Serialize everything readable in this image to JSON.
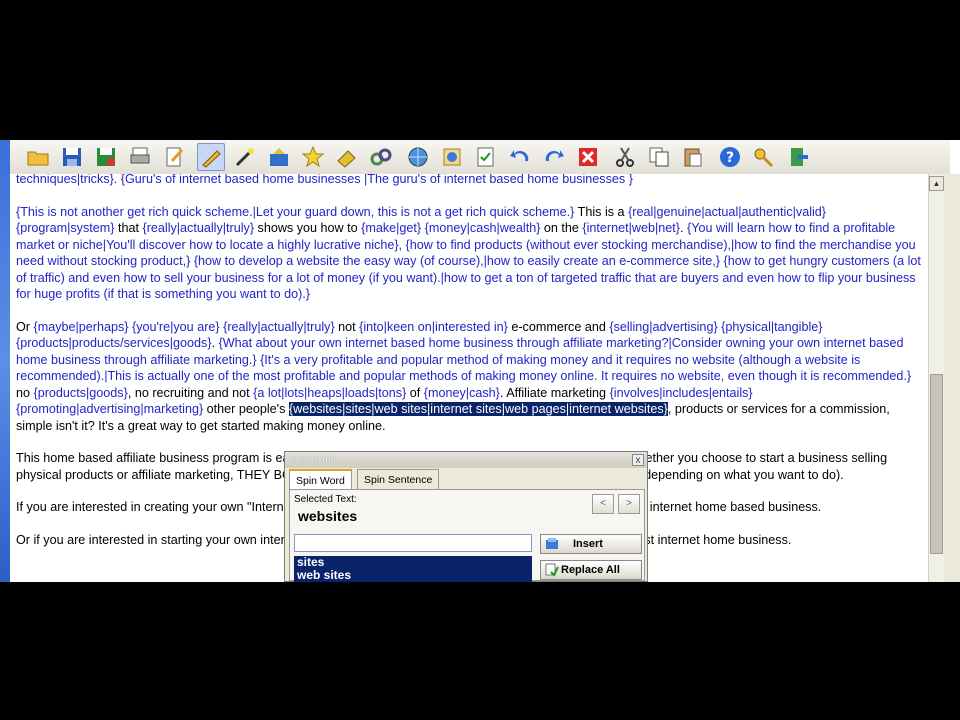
{
  "colors": {
    "spin": "#2323c8",
    "selection": "#0a246a",
    "toolbar": "#ece9d8"
  },
  "toolbar": {
    "icons": [
      "open-folder-icon",
      "save-icon",
      "save-as-icon",
      "print-icon",
      "edit-document-icon",
      "pencil-icon",
      "wand-icon",
      "magic-chest-icon",
      "star-icon",
      "eraser-icon",
      "link-icon",
      "globe-icon",
      "spell-check-icon",
      "checklist-icon",
      "undo-icon",
      "redo-icon",
      "delete-icon",
      "cut-icon",
      "copy-icon",
      "paste-icon",
      "help-icon",
      "key-icon",
      "exit-icon"
    ]
  },
  "document": {
    "line0": [
      {
        "t": "techniques|tricks}. {Guru's of internet based home businesses |The guru's of internet based home businesses }",
        "s": true
      }
    ],
    "para1": [
      {
        "t": "{This is not another get rich quick scheme.|Let your guard down, this is not a get rich quick scheme.}",
        "s": true
      },
      {
        "t": " This is a ",
        "s": false
      },
      {
        "t": "{real|genuine|actual|authentic|valid}",
        "s": true
      },
      {
        "t": " ",
        "s": false
      },
      {
        "t": "{program|system}",
        "s": true
      },
      {
        "t": " that ",
        "s": false
      },
      {
        "t": "{really|actually|truly}",
        "s": true
      },
      {
        "t": " shows you how to ",
        "s": false
      },
      {
        "t": "{make|get}",
        "s": true
      },
      {
        "t": " ",
        "s": false
      },
      {
        "t": "{money|cash|wealth}",
        "s": true
      },
      {
        "t": " on the ",
        "s": false
      },
      {
        "t": "{internet|web|net}",
        "s": true
      },
      {
        "t": ". ",
        "s": false
      },
      {
        "t": "{You will learn how to find a profitable market or niche|You'll discover how to locate a highly lucrative niche}, {how to find products (without ever stocking merchandise),|how to find the merchandise you need without stocking product,} {how to develop a website the easy way (of course),|how to easily create an e-commerce site,} {how to get hungry customers (a lot of traffic) and even how to sell your business for a lot of money (if you want).|how to get a ton of targeted traffic that are buyers and even how to flip your business for huge profits (if that is something you want to do).}",
        "s": true
      }
    ],
    "para2": [
      {
        "t": "Or ",
        "s": false
      },
      {
        "t": "{maybe|perhaps}",
        "s": true
      },
      {
        "t": " ",
        "s": false
      },
      {
        "t": "{you're|you are}",
        "s": true
      },
      {
        "t": " ",
        "s": false
      },
      {
        "t": "{really|actually|truly}",
        "s": true
      },
      {
        "t": " not ",
        "s": false
      },
      {
        "t": "{into|keen on|interested in}",
        "s": true
      },
      {
        "t": " e-commerce and ",
        "s": false
      },
      {
        "t": "{selling|advertising}",
        "s": true
      },
      {
        "t": " ",
        "s": false
      },
      {
        "t": "{physical|tangible}",
        "s": true
      },
      {
        "t": " ",
        "s": false
      },
      {
        "t": "{products|products/services|goods}",
        "s": true
      },
      {
        "t": ". ",
        "s": false
      },
      {
        "t": "{What about your own internet based home business through affiliate marketing?|Consider owning your own internet based home business through affiliate marketing.} {It's a very profitable and popular method of making money and it requires no website (although a website is recommended).|This is actually one of the most profitable and popular methods of making money online. It requires no website, even though it is recommended.}",
        "s": true
      },
      {
        "t": " no ",
        "s": false
      },
      {
        "t": "{products|goods}",
        "s": true
      },
      {
        "t": ", no recruiting and not ",
        "s": false
      },
      {
        "t": "{a lot|lots|heaps|loads|tons}",
        "s": true
      },
      {
        "t": " of ",
        "s": false
      },
      {
        "t": "{money|cash}",
        "s": true
      },
      {
        "t": ". Affiliate marketing ",
        "s": false
      },
      {
        "t": "{involves|includes|entails}",
        "s": true
      },
      {
        "t": " ",
        "s": false
      },
      {
        "t": "{promoting|advertising|marketing}",
        "s": true
      },
      {
        "t": " other people's ",
        "s": false
      },
      {
        "t": "{websites|sites|web sites|internet sites|web pages|internet websites}",
        "s": true,
        "sel": true
      },
      {
        "t": ", products or services for a commission, simple isn't it? It's a great way to get started making money online.",
        "s": false
      }
    ],
    "para3": [
      {
        "t": "This home based affiliate business progra",
        "s": false
      },
      {
        "t": "...",
        "s": false,
        "hidden": true
      },
      {
        "t": "m is easy to follow and even easier to implement and make money.  Whether you choose to sta",
        "s": false
      },
      {
        "t": "rt a business selling physical products or affiliate marketing, THEY BOTH WORK. These programs have defi",
        "s": false
      },
      {
        "t": "nitely different outcomes depending on what you want to do).",
        "s": false
      }
    ],
    "para4": [
      {
        "t": "If you are interested in creating your own \"I",
        "s": false
      },
      {
        "t": "nternet based business (selling physical products) click here - the best internet home based business.",
        "s": false
      }
    ],
    "para5": [
      {
        "t": "Or if you are interested in starting your own internet based business through affiliate marketing click here - the best internet home business.",
        "s": false
      }
    ]
  },
  "dialog": {
    "title": "Synonyms",
    "close": "x",
    "tab_word": "Spin Word",
    "tab_sentence": "Spin Sentence",
    "selected_label": "Selected Text:",
    "selected_word": "websites",
    "prev": "<",
    "next": ">",
    "input_value": "",
    "synonyms": [
      "sites",
      "web sites"
    ],
    "insert_label": "Insert",
    "replace_label": "Replace All"
  }
}
